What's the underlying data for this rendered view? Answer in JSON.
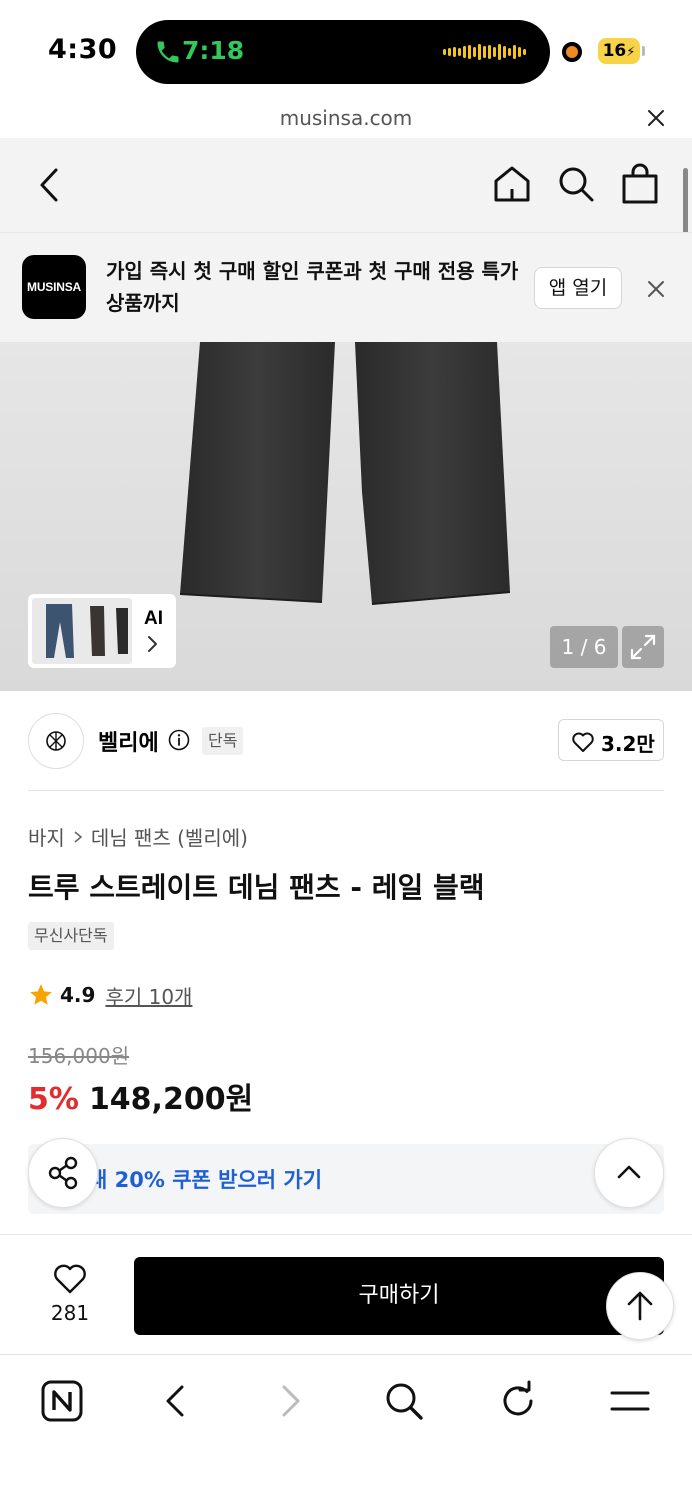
{
  "status_bar": {
    "time": "4:30",
    "call_time": "7:18",
    "battery": "16"
  },
  "browser": {
    "url": "musinsa.com"
  },
  "app_banner": {
    "logo_text": "MUSINSA",
    "message": "가입 즉시 첫 구매 할인 쿠폰과 첫 구매 전용 특가 상품까지",
    "open_app_label": "앱 열기"
  },
  "gallery": {
    "ai_label": "AI",
    "page_indicator": "1 / 6"
  },
  "brand": {
    "name": "벨리에",
    "tag": "단독",
    "like_count": "3.2만"
  },
  "product": {
    "breadcrumb": [
      "바지",
      "데님 팬츠 (벨리에)"
    ],
    "title": "트루 스트레이트 데님 팬츠 - 레일 블랙",
    "exclusive_tag": "무신사단독",
    "rating": "4.9",
    "review_link": "후기 10개",
    "original_price": "156,000원",
    "discount": "5%",
    "sale_price": "148,200원",
    "coupon_text": "대 20% 쿠폰 받으러 가기"
  },
  "purchase_bar": {
    "wish_count": "281",
    "buy_label": "구매하기"
  },
  "colors": {
    "discount_red": "#e12d2d",
    "coupon_blue": "#1f5fd6",
    "call_green": "#34c759",
    "star_orange": "#f7a400"
  }
}
